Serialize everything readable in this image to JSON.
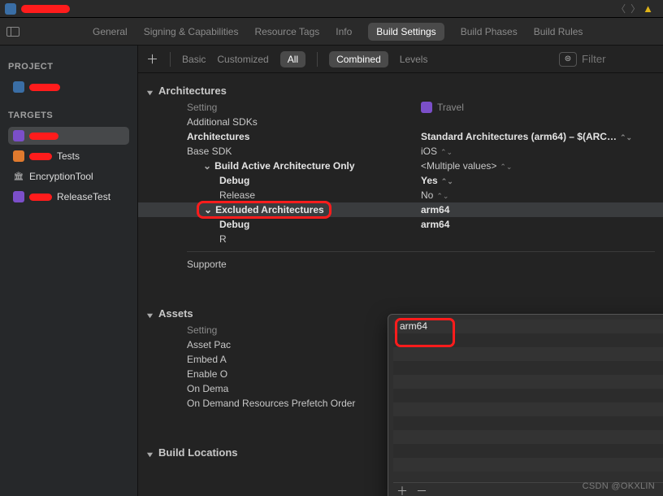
{
  "titlebar": {
    "warn_glyph": "▲"
  },
  "tabs": {
    "general": "General",
    "signing": "Signing & Capabilities",
    "resource": "Resource Tags",
    "info": "Info",
    "build_settings": "Build Settings",
    "build_phases": "Build Phases",
    "build_rules": "Build Rules"
  },
  "sidebar": {
    "project_hdr": "PROJECT",
    "targets_hdr": "TARGETS",
    "project_item": "",
    "targets": [
      {
        "label": ""
      },
      {
        "label": "Tests",
        "suffix": "Tests"
      },
      {
        "label": "EncryptionTool"
      },
      {
        "label": "ReleaseTest",
        "suffix": "ReleaseTest"
      }
    ]
  },
  "toolbar": {
    "basic": "Basic",
    "customized": "Customized",
    "all": "All",
    "combined": "Combined",
    "levels": "Levels",
    "filter_placeholder": "Filter"
  },
  "columns": {
    "setting": "Setting",
    "target": "Travel"
  },
  "arch": {
    "header": "Architectures",
    "additional_sdks": "Additional SDKs",
    "architectures": "Architectures",
    "architectures_val": "Standard Architectures (arm64) – $(ARC…",
    "base_sdk": "Base SDK",
    "base_sdk_val": "iOS",
    "baao": "Build Active Architecture Only",
    "baao_val": "<Multiple values>",
    "debug": "Debug",
    "release": "Release",
    "yes": "Yes",
    "no": "No",
    "excluded": "Excluded Architectures",
    "excluded_val": "arm64",
    "excluded_debug": "Debug",
    "excluded_debug_val": "arm64",
    "excluded_release_short": "R",
    "supported_short": "Supporte",
    "asset_pack_short": "Asset Pac",
    "embed_short": "Embed A",
    "enable_short": "Enable O",
    "ondemand_short": "On Dema",
    "ondemand_full": "On Demand Resources Prefetch Order"
  },
  "assets": {
    "header": "Assets",
    "setting": "Setting"
  },
  "buildloc": {
    "header": "Build Locations"
  },
  "popover": {
    "value": "arm64"
  },
  "watermark": "CSDN @OKXLIN"
}
